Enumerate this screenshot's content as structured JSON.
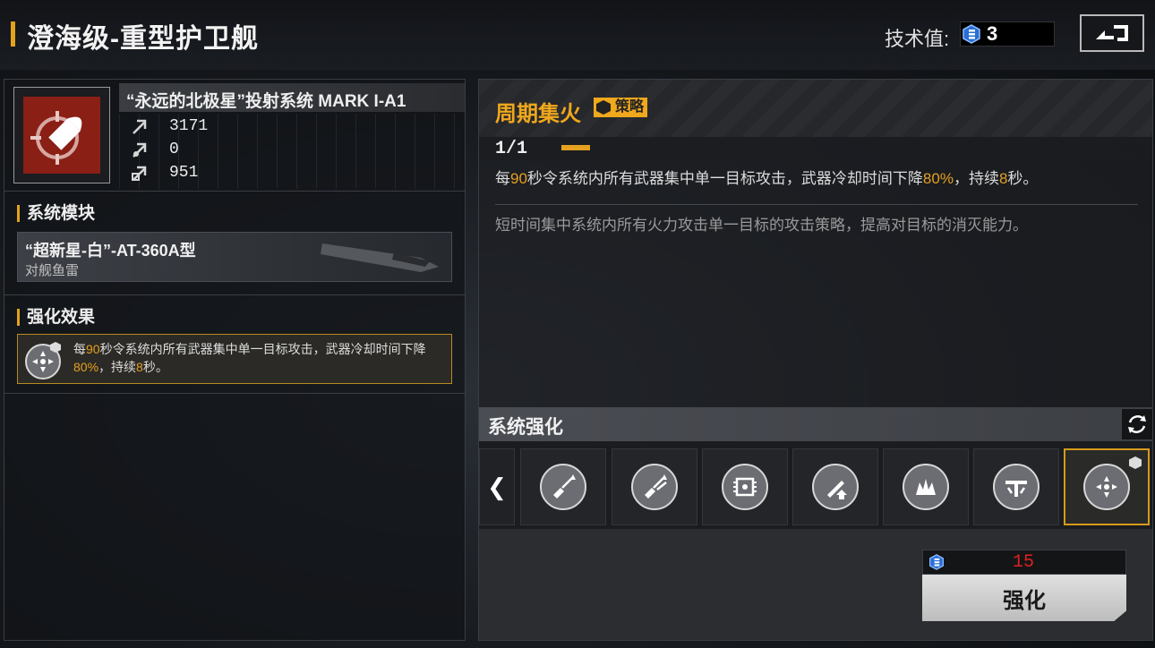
{
  "header": {
    "title": "澄海级-重型护卫舰",
    "tech_label": "技术值:",
    "tech_value": "3",
    "back_icon": "back-return-icon"
  },
  "weapon": {
    "name": "“永远的北极星”投射系统 MARK I-A1",
    "icon": "bullet-crosshair-icon",
    "stats": [
      {
        "icon": "stat-up-arrow-icon",
        "value": "3171"
      },
      {
        "icon": "stat-burst-icon",
        "value": "0"
      },
      {
        "icon": "stat-shield-arrow-icon",
        "value": "951"
      }
    ]
  },
  "module": {
    "section_title": "系统模块",
    "name": "“超新星-白”-AT-360A型",
    "type": "对舰鱼雷"
  },
  "effect": {
    "section_title": "强化效果",
    "icon": "focus-fire-icon",
    "text_parts": [
      "每",
      "90",
      "秒令系统内所有武器集中单一目标攻击，武器冷却时间下降",
      "80%",
      "，持续",
      "8",
      "秒。"
    ]
  },
  "skill": {
    "name": "周期集火",
    "tag": "策略",
    "level": "1/1",
    "desc_parts": [
      "每",
      "90",
      "秒令系统内所有武器集中单一目标攻击，武器冷却时间下降",
      "80%",
      "，持续",
      "8",
      "秒。"
    ],
    "flavor": "短时间集中系统内所有火力攻击单一目标的攻击策略，提高对目标的消灭能力。"
  },
  "enhance": {
    "title": "系统强化",
    "prev_glyph": "❮",
    "slots": [
      {
        "icon": "guitar-arrow-icon",
        "selected": false
      },
      {
        "icon": "guitar-double-arrow-icon",
        "selected": false
      },
      {
        "icon": "chip-signal-icon",
        "selected": false
      },
      {
        "icon": "pencil-upgrade-icon",
        "selected": false
      },
      {
        "icon": "burst-crown-icon",
        "selected": false
      },
      {
        "icon": "shield-tee-icon",
        "selected": false
      },
      {
        "icon": "focus-fire-icon",
        "selected": true
      }
    ],
    "cost": "15",
    "upgrade_label": "强化"
  },
  "colors": {
    "accent": "#e6a020",
    "cost_red": "#e02020"
  }
}
